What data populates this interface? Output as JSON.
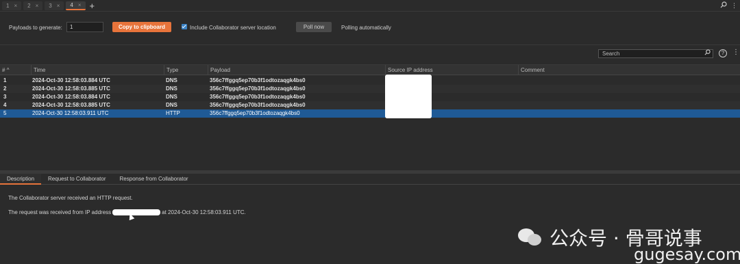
{
  "tabs": [
    {
      "label": "1",
      "close": "×"
    },
    {
      "label": "2",
      "close": "×"
    },
    {
      "label": "3",
      "close": "×"
    },
    {
      "label": "4",
      "close": "×"
    }
  ],
  "tab_add": "+",
  "controls": {
    "payloads_label": "Payloads to generate:",
    "payloads_value": "1",
    "copy_button": "Copy to clipboard",
    "include_label": "Include Collaborator server location",
    "include_checked": true,
    "poll_button": "Poll now",
    "poll_status": "Polling automatically"
  },
  "search": {
    "placeholder": "Search"
  },
  "table": {
    "columns": [
      "#",
      "Time",
      "Type",
      "Payload",
      "Source IP address",
      "Comment"
    ],
    "rows": [
      {
        "num": "1",
        "time": "2024-Oct-30 12:58:03.884 UTC",
        "type": "DNS",
        "payload": "356c7ffggq5ep70b3f1odtozaqgk4bs0"
      },
      {
        "num": "2",
        "time": "2024-Oct-30 12:58:03.885 UTC",
        "type": "DNS",
        "payload": "356c7ffggq5ep70b3f1odtozaqgk4bs0"
      },
      {
        "num": "3",
        "time": "2024-Oct-30 12:58:03.884 UTC",
        "type": "DNS",
        "payload": "356c7ffggq5ep70b3f1odtozaqgk4bs0"
      },
      {
        "num": "4",
        "time": "2024-Oct-30 12:58:03.885 UTC",
        "type": "DNS",
        "payload": "356c7ffggq5ep70b3f1odtozaqgk4bs0"
      },
      {
        "num": "5",
        "time": "2024-Oct-30 12:58:03.911 UTC",
        "type": "HTTP",
        "payload": "356c7ffggq5ep70b3f1odtozaqgk4bs0"
      }
    ]
  },
  "bottom_tabs": [
    "Description",
    "Request to Collaborator",
    "Response from Collaborator"
  ],
  "description": {
    "line1": "The Collaborator server received an HTTP request.",
    "line2_prefix": "The request was received from IP address",
    "line2_suffix": "at 2024-Oct-30 12:58:03.911 UTC."
  },
  "watermark": {
    "line1": "公众号 · 骨哥说事",
    "line2": "gugesay.com"
  },
  "colors": {
    "accent": "#e8743b",
    "selection": "#1f5a96"
  }
}
